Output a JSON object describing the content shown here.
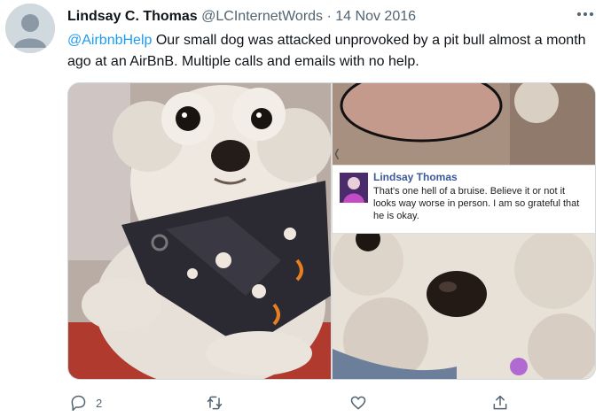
{
  "tweet": {
    "author_name": "Lindsay C. Thomas",
    "author_handle": "@LCInternetWords",
    "separator": "·",
    "date": "14 Nov 2016",
    "mention": "@AirbnbHelp",
    "text": " Our small dog was attacked unprovoked by a pit bull almost a month ago at an AirBnB. Multiple calls and emails with no help."
  },
  "embedded_comment": {
    "name": "Lindsay Thomas",
    "text": "That's one hell of a bruise. Believe it or not it looks way worse in person. I am so grateful that he is okay."
  },
  "actions": {
    "reply_count": "2"
  },
  "icons": {
    "reply": "reply-icon",
    "retweet": "retweet-icon",
    "like": "heart-icon",
    "share": "share-icon",
    "more": "more-options-icon"
  },
  "colors": {
    "link": "#1d9bf0",
    "secondary_text": "#536471",
    "facebook_name": "#3b5998"
  }
}
